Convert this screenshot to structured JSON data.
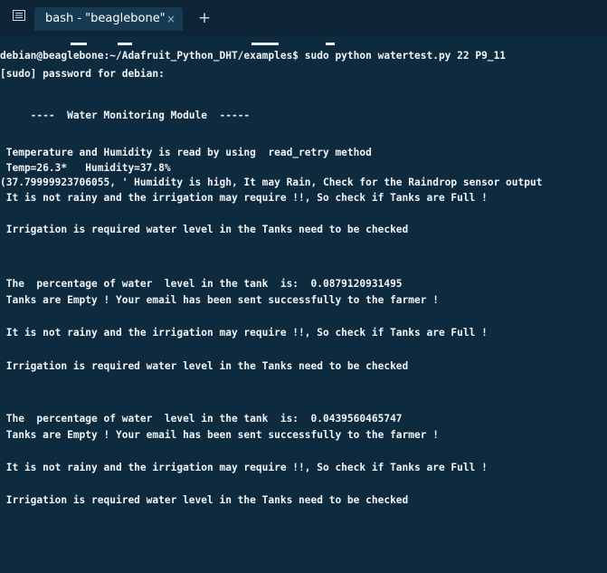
{
  "tab": {
    "title": "bash - \"beaglebone\"",
    "close": "×",
    "new_tab": "+"
  },
  "terminal": {
    "prompt": "debian@beaglebone:~/Adafruit_Python_DHT/examples$ sudo python watertest.py 22 P9_11",
    "sudo": "[sudo] password for debian:",
    "header": "     ----  Water Monitoring Module  -----",
    "method": " Temperature and Humidity is read by using  read_retry method",
    "readings": " Temp=26.3*   Humidity=37.8%",
    "tuple": "(37.79999923706055, ' Humidity is high, It may Rain, Check for the Raindrop sensor output",
    "rainy_1": " It is not rainy and the irrigation may require !!, So check if Tanks are Full !",
    "irrigation_1": " Irrigation is required water level in the Tanks need to be checked",
    "percentage_1": " The  percentage of water  level in the tank  is:  0.0879120931495",
    "empty_1": " Tanks are Empty ! Your email has been sent successfully to the farmer !",
    "rainy_2": " It is not rainy and the irrigation may require !!, So check if Tanks are Full !",
    "irrigation_2": " Irrigation is required water level in the Tanks need to be checked",
    "percentage_2": " The  percentage of water  level in the tank  is:  0.0439560465747",
    "empty_2": " Tanks are Empty ! Your email has been sent successfully to the farmer !",
    "rainy_3": " It is not rainy and the irrigation may require !!, So check if Tanks are Full !",
    "irrigation_3": " Irrigation is required water level in the Tanks need to be checked"
  }
}
